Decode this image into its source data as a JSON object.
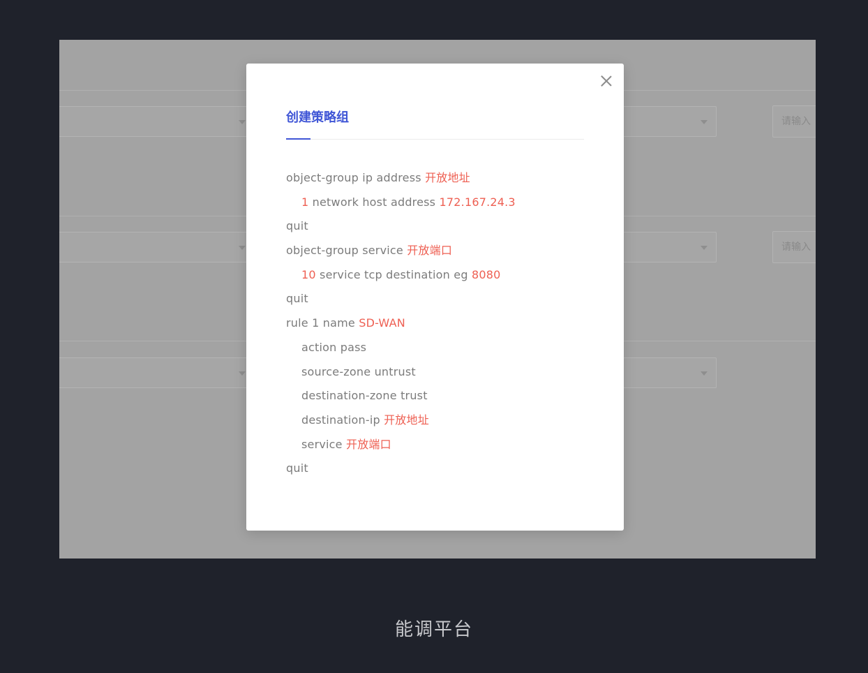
{
  "background": {
    "input_placeholder": "请输入"
  },
  "modal": {
    "tab_label": "创建策略组",
    "lines": [
      {
        "indent": false,
        "segments": [
          {
            "text": "object-group ip address ",
            "hl": false
          },
          {
            "text": "开放地址",
            "hl": true
          }
        ]
      },
      {
        "indent": true,
        "segments": [
          {
            "text": "1",
            "hl": true
          },
          {
            "text": " network host address ",
            "hl": false
          },
          {
            "text": "172.167.24.3",
            "hl": true
          }
        ]
      },
      {
        "indent": false,
        "segments": [
          {
            "text": "quit",
            "hl": false
          }
        ]
      },
      {
        "indent": false,
        "segments": [
          {
            "text": "object-group service ",
            "hl": false
          },
          {
            "text": "开放端口",
            "hl": true
          }
        ]
      },
      {
        "indent": true,
        "segments": [
          {
            "text": "10",
            "hl": true
          },
          {
            "text": " service tcp destination eg ",
            "hl": false
          },
          {
            "text": "8080",
            "hl": true
          }
        ]
      },
      {
        "indent": false,
        "segments": [
          {
            "text": "quit",
            "hl": false
          }
        ]
      },
      {
        "indent": false,
        "segments": [
          {
            "text": "rule 1 name ",
            "hl": false
          },
          {
            "text": "SD-WAN",
            "hl": true
          }
        ]
      },
      {
        "indent": true,
        "segments": [
          {
            "text": "action pass",
            "hl": false
          }
        ]
      },
      {
        "indent": true,
        "segments": [
          {
            "text": "source-zone untrust",
            "hl": false
          }
        ]
      },
      {
        "indent": true,
        "segments": [
          {
            "text": "destination-zone trust",
            "hl": false
          }
        ]
      },
      {
        "indent": true,
        "segments": [
          {
            "text": "destination-ip ",
            "hl": false
          },
          {
            "text": "开放地址",
            "hl": true
          }
        ]
      },
      {
        "indent": true,
        "segments": [
          {
            "text": "service ",
            "hl": false
          },
          {
            "text": "开放端口",
            "hl": true
          }
        ]
      },
      {
        "indent": false,
        "segments": [
          {
            "text": "quit",
            "hl": false
          }
        ]
      }
    ]
  },
  "footer": {
    "caption": "能调平台"
  },
  "colors": {
    "page_bg": "#1f222b",
    "accent": "#4056d6",
    "highlight": "#ee5f52",
    "code_text": "#7b7b7b"
  }
}
